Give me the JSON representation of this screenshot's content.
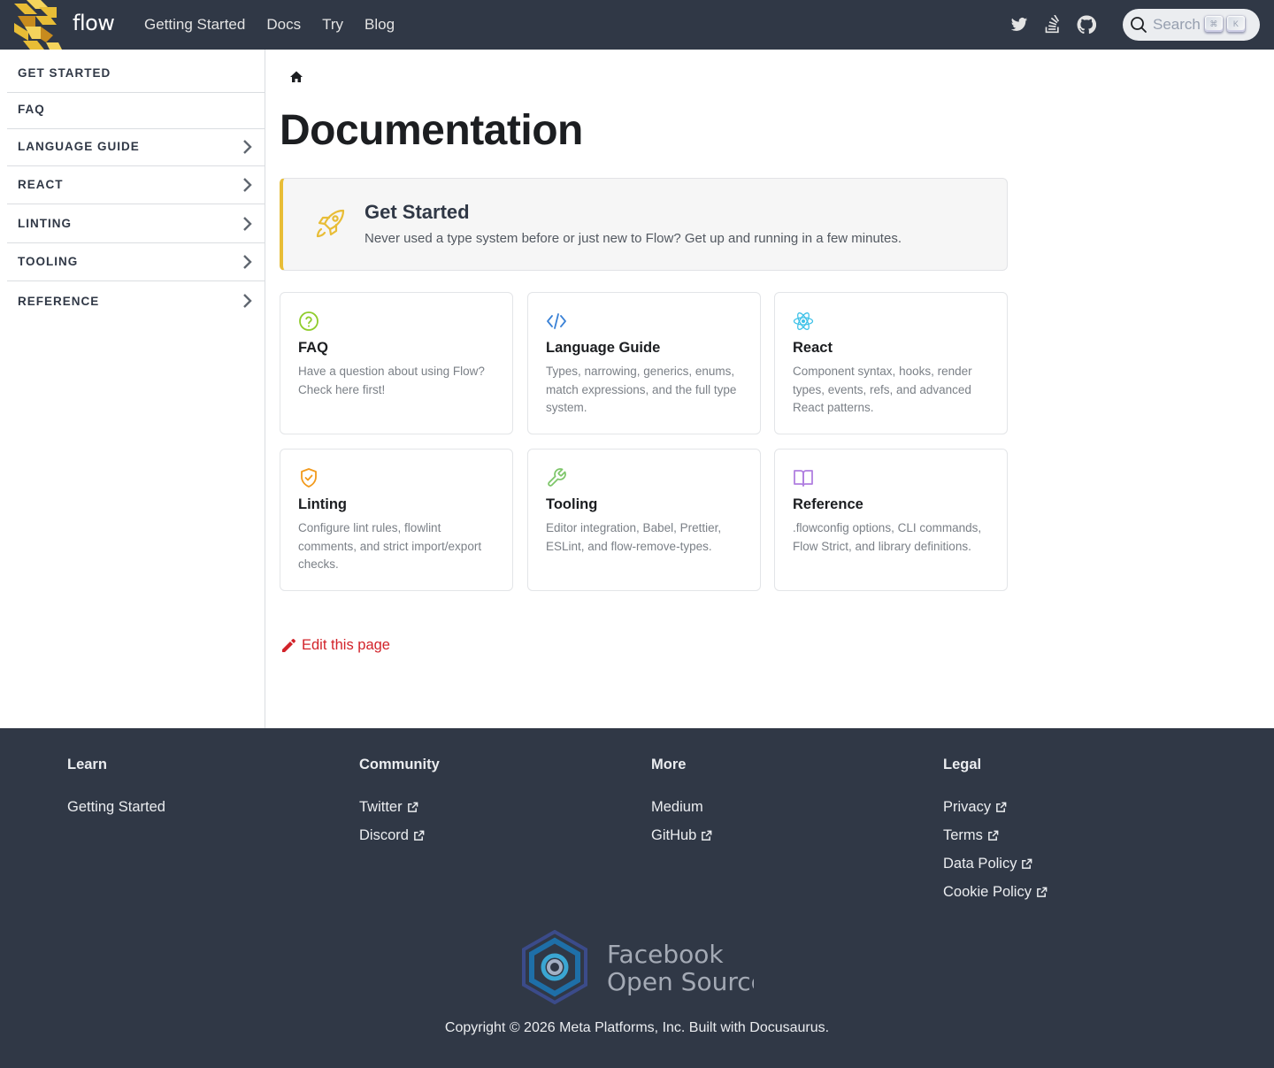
{
  "navbar": {
    "brand_text": "flow",
    "links": [
      "Getting Started",
      "Docs",
      "Try",
      "Blog"
    ],
    "icons": [
      "twitter-icon",
      "stack-overflow-icon",
      "github-icon"
    ],
    "search": {
      "label": "Search",
      "key1": "⌘",
      "key2": "K"
    }
  },
  "sidebar": {
    "items": [
      {
        "label": "GET STARTED",
        "expandable": false
      },
      {
        "label": "FAQ",
        "expandable": false
      },
      {
        "label": "LANGUAGE GUIDE",
        "expandable": true
      },
      {
        "label": "REACT",
        "expandable": true
      },
      {
        "label": "LINTING",
        "expandable": true
      },
      {
        "label": "TOOLING",
        "expandable": true
      },
      {
        "label": "REFERENCE",
        "expandable": true
      }
    ]
  },
  "main": {
    "title": "Documentation",
    "hero": {
      "title": "Get Started",
      "description": "Never used a type system before or just new to Flow? Get up and running in a few minutes.",
      "icon": "rocket-icon",
      "accent": "#e8bd36"
    },
    "cards": [
      {
        "title": "FAQ",
        "description": "Have a question about using Flow? Check here first!",
        "icon": "question-circle-icon",
        "color": "#8fcc2b"
      },
      {
        "title": "Language Guide",
        "description": "Types, narrowing, generics, enums, match expressions, and the full type system.",
        "icon": "code-icon",
        "color": "#3b82d6"
      },
      {
        "title": "React",
        "description": "Component syntax, hooks, render types, events, refs, and advanced React patterns.",
        "icon": "react-icon",
        "color": "#3fc2e8"
      },
      {
        "title": "Linting",
        "description": "Configure lint rules, flowlint comments, and strict import/export checks.",
        "icon": "shield-check-icon",
        "color": "#f29a1c"
      },
      {
        "title": "Tooling",
        "description": "Editor integration, Babel, Prettier, ESLint, and flow-remove-types.",
        "icon": "wrench-icon",
        "color": "#7ec66a"
      },
      {
        "title": "Reference",
        "description": ".flowconfig options, CLI commands, Flow Strict, and library definitions.",
        "icon": "book-icon",
        "color": "#b07fe0"
      }
    ],
    "edit_link": "Edit this page"
  },
  "footer": {
    "columns": [
      {
        "title": "Learn",
        "links": [
          {
            "label": "Getting Started",
            "external": false
          }
        ]
      },
      {
        "title": "Community",
        "links": [
          {
            "label": "Twitter",
            "external": true
          },
          {
            "label": "Discord",
            "external": true
          }
        ]
      },
      {
        "title": "More",
        "links": [
          {
            "label": "Medium",
            "external": false
          },
          {
            "label": "GitHub",
            "external": true
          }
        ]
      },
      {
        "title": "Legal",
        "links": [
          {
            "label": "Privacy",
            "external": true
          },
          {
            "label": "Terms",
            "external": true
          },
          {
            "label": "Data Policy",
            "external": true
          },
          {
            "label": "Cookie Policy",
            "external": true
          }
        ]
      }
    ],
    "logo_text_line1": "Facebook",
    "logo_text_line2": "Open Source",
    "copyright": "Copyright © 2026 Meta Platforms, Inc. Built with Docusaurus."
  }
}
